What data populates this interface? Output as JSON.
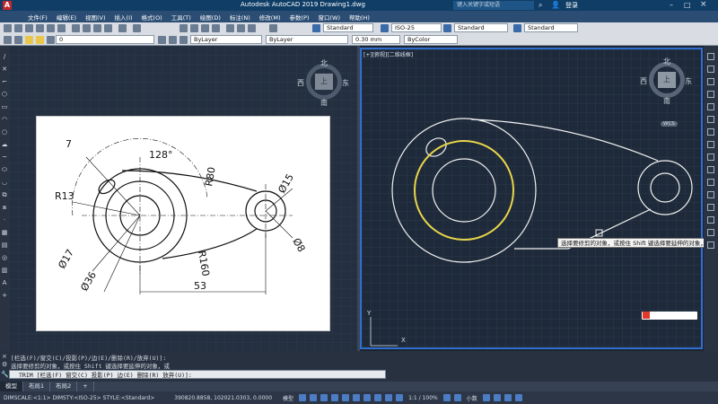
{
  "app": {
    "title": "Autodesk AutoCAD 2019   Drawing1.dwg",
    "search_placeholder": "键入关键字或短语",
    "login": "登录"
  },
  "menu": [
    "文件(F)",
    "编辑(E)",
    "视图(V)",
    "插入(I)",
    "格式(O)",
    "工具(T)",
    "绘图(D)",
    "标注(N)",
    "修改(M)",
    "参数(P)",
    "窗口(W)",
    "帮助(H)"
  ],
  "toolbar1": {
    "text_style": "Standard",
    "dim_style": "ISO-25",
    "table_style": "Standard",
    "mleader_style": "Standard"
  },
  "toolbar2": {
    "layer": "0",
    "color": "ByLayer",
    "linetype": "ByLayer",
    "lineweight": "0.30 mm",
    "plotstyle": "ByColor"
  },
  "left_viewport": {
    "compass": {
      "n": "北",
      "s": "南",
      "e": "东",
      "w": "西",
      "center": "上"
    },
    "sheet": {
      "dims": [
        "7",
        "128°",
        "R13",
        "R80",
        "Ø15",
        "R160",
        "Ø8",
        "Ø17",
        "Ø36",
        "53"
      ]
    }
  },
  "right_viewport": {
    "label": "[+][俯视][二维线框]",
    "compass": {
      "n": "北",
      "s": "南",
      "e": "东",
      "w": "西",
      "center": "上"
    },
    "wcs": "WCS",
    "tooltip": "选择要修剪的对象，或按住 Shift 键选择要延伸的对象，或",
    "ucs_y": "Y",
    "ucs_x": "X"
  },
  "command": {
    "line1": "[栏选(F)/窗交(C)/投影(P)/边(E)/删除(R)/放弃(U)]:",
    "line2": "选择要修剪的对象，或按住 Shift 键选择要延伸的对象，或",
    "prompt": "TRIM [栏选(F) 窗交(C) 投影(P) 边(E) 删除(R) 放弃(U)]:"
  },
  "tabs": [
    "模型",
    "布局1",
    "布局2",
    "+"
  ],
  "status": {
    "dimscale": "DIMSCALE:<1:1> DIMSTY:<ISO-25> STYLE:<Standard>",
    "coords": "390820.8858, 102021.0303, 0.0000",
    "model": "模型",
    "scale": "1:1 / 100%",
    "units": "小数"
  },
  "colors": {
    "accent": "#2f6fd0",
    "highlight_circle": "#e8d44a",
    "drawing_bg": "#1e2a3a"
  }
}
